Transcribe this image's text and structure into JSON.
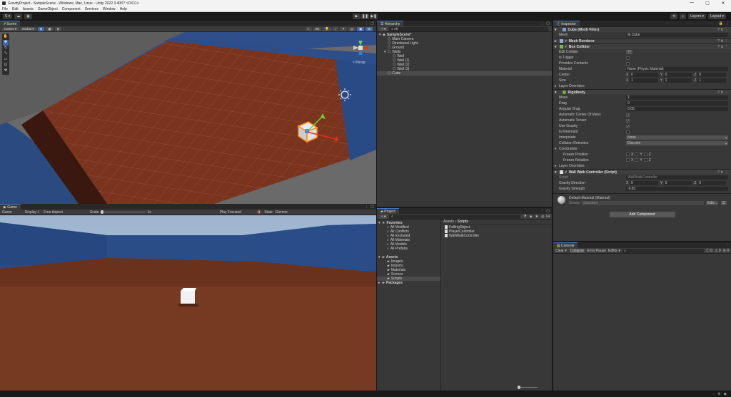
{
  "window": {
    "title": "GravityProject - SampleScene - Windows, Mac, Linux - Unity 2022.3.40f1* <DX11>",
    "controls": [
      "—",
      "▢",
      "✕"
    ]
  },
  "menu": [
    "File",
    "Edit",
    "Assets",
    "GameObject",
    "Component",
    "Services",
    "Window",
    "Help"
  ],
  "toolbar": {
    "account": "S ▾",
    "layers": "Layers",
    "layout": "Layout",
    "play": "▶",
    "pause": "❚❚",
    "step": "▶❚"
  },
  "scene": {
    "tab": "Scene",
    "pivot": "Center",
    "space": "Global",
    "mode2d": "2D",
    "persp": "< Persp"
  },
  "game": {
    "tab": "Game",
    "mode": "Game",
    "display": "Display 1",
    "aspect": "Free Aspect",
    "scale_label": "Scale",
    "scale_value": "1x",
    "play_focused": "Play Focused",
    "stats": "Stats",
    "gizmos": "Gizmos"
  },
  "hierarchy": {
    "tab": "Hierarchy",
    "search": "All",
    "items": [
      {
        "label": "SampleScene*",
        "indent": 0,
        "arrow": "▾",
        "icon": "◆"
      },
      {
        "label": "Main Camera",
        "indent": 1,
        "arrow": "",
        "icon": "⬡"
      },
      {
        "label": "Directional Light",
        "indent": 1,
        "arrow": "",
        "icon": "⬡"
      },
      {
        "label": "Ground",
        "indent": 1,
        "arrow": "",
        "icon": "⬡"
      },
      {
        "label": "Walls",
        "indent": 1,
        "arrow": "▾",
        "icon": "⬡"
      },
      {
        "label": "Wall",
        "indent": 2,
        "arrow": "",
        "icon": "⬡"
      },
      {
        "label": "Wall (1)",
        "indent": 2,
        "arrow": "",
        "icon": "⬡"
      },
      {
        "label": "Wall (2)",
        "indent": 2,
        "arrow": "",
        "icon": "⬡"
      },
      {
        "label": "Wall (3)",
        "indent": 2,
        "arrow": "",
        "icon": "⬡"
      },
      {
        "label": "Cube",
        "indent": 1,
        "arrow": "",
        "icon": "⬡"
      }
    ]
  },
  "project": {
    "tab": "Project",
    "count": "14",
    "breadcrumb_root": "Assets",
    "breadcrumb_sep": "›",
    "breadcrumb_leaf": "Scripts",
    "tree": [
      {
        "label": "Favorites",
        "indent": 0,
        "arrow": "▾",
        "icon": "★"
      },
      {
        "label": "All Modified",
        "indent": 1,
        "arrow": "",
        "icon": "⌕"
      },
      {
        "label": "All Conflicts",
        "indent": 1,
        "arrow": "",
        "icon": "⌕"
      },
      {
        "label": "All Excluded",
        "indent": 1,
        "arrow": "",
        "icon": "⌕"
      },
      {
        "label": "All Materials",
        "indent": 1,
        "arrow": "",
        "icon": "⌕"
      },
      {
        "label": "All Models",
        "indent": 1,
        "arrow": "",
        "icon": "⌕"
      },
      {
        "label": "All Prefabs",
        "indent": 1,
        "arrow": "",
        "icon": "⌕"
      },
      {
        "label": "",
        "indent": 0,
        "arrow": "",
        "icon": ""
      },
      {
        "label": "Assets",
        "indent": 0,
        "arrow": "▾",
        "icon": "▰"
      },
      {
        "label": "Images",
        "indent": 1,
        "arrow": "",
        "icon": "▰"
      },
      {
        "label": "Imports",
        "indent": 1,
        "arrow": "",
        "icon": "▰"
      },
      {
        "label": "Materials",
        "indent": 1,
        "arrow": "",
        "icon": "▰"
      },
      {
        "label": "Scenes",
        "indent": 1,
        "arrow": "",
        "icon": "▰"
      },
      {
        "label": "Scripts",
        "indent": 1,
        "arrow": "",
        "icon": "▰"
      },
      {
        "label": "Packages",
        "indent": 0,
        "arrow": "▸",
        "icon": "▰"
      }
    ],
    "files": [
      "FallingObject",
      "PlayerController",
      "WallWalkController"
    ]
  },
  "inspector": {
    "tab": "Inspector",
    "mesh_filter": {
      "title": "Cube (Mesh Filter)",
      "mesh_label": "Mesh",
      "mesh_value": "Cube"
    },
    "mesh_renderer": {
      "title": "Mesh Renderer"
    },
    "box_collider": {
      "title": "Box Collider",
      "edit": "Edit Collider",
      "is_trigger": "Is Trigger",
      "provides_contacts": "Provides Contacts",
      "material": "Material",
      "material_value": "None (Physic Material)",
      "center": "Center",
      "size": "Size",
      "layer_overrides": "Layer Overrides",
      "center_xyz": [
        [
          "X",
          "0"
        ],
        [
          "Y",
          "0"
        ],
        [
          "Z",
          "0"
        ]
      ],
      "size_xyz": [
        [
          "X",
          "1"
        ],
        [
          "Y",
          "1"
        ],
        [
          "Z",
          "1"
        ]
      ]
    },
    "rigidbody": {
      "title": "Rigidbody",
      "mass": "Mass",
      "mass_v": "1",
      "drag": "Drag",
      "drag_v": "0",
      "angular": "Angular Drag",
      "angular_v": "0.05",
      "acom": "Automatic Center Of Mass",
      "atensor": "Automatic Tensor",
      "gravity": "Use Gravity",
      "kinematic": "Is Kinematic",
      "interpolate": "Interpolate",
      "interpolate_v": "None",
      "collision": "Collision Detection",
      "collision_v": "Discrete",
      "constraints": "Constraints",
      "freeze_pos": "Freeze Position",
      "freeze_rot": "Freeze Rotation",
      "layer_overrides": "Layer Overrides",
      "check": "✓",
      "axes": [
        "X",
        "Y",
        "Z"
      ]
    },
    "wall_walk": {
      "title": "Wall Walk Controller (Script)",
      "script": "Script",
      "script_v": "WallWalkController",
      "gdir": "Gravity Direction",
      "gdir_xyz": [
        [
          "X",
          "0"
        ],
        [
          "Y",
          "0"
        ],
        [
          "Z",
          "0"
        ]
      ],
      "gstr": "Gravity Strength",
      "gstr_v": "-9.81"
    },
    "material": {
      "title": "Default-Material (Material)",
      "shader": "Shader",
      "shader_v": "Standard",
      "edit": "Edit...",
      "list": "☰"
    },
    "add_component": "Add Component"
  },
  "console": {
    "tab": "Console",
    "clear": "Clear",
    "collapse": "Collapse",
    "error_pause": "Error Pause",
    "editor": "Editor",
    "counts": [
      "0",
      "0",
      "0"
    ]
  }
}
